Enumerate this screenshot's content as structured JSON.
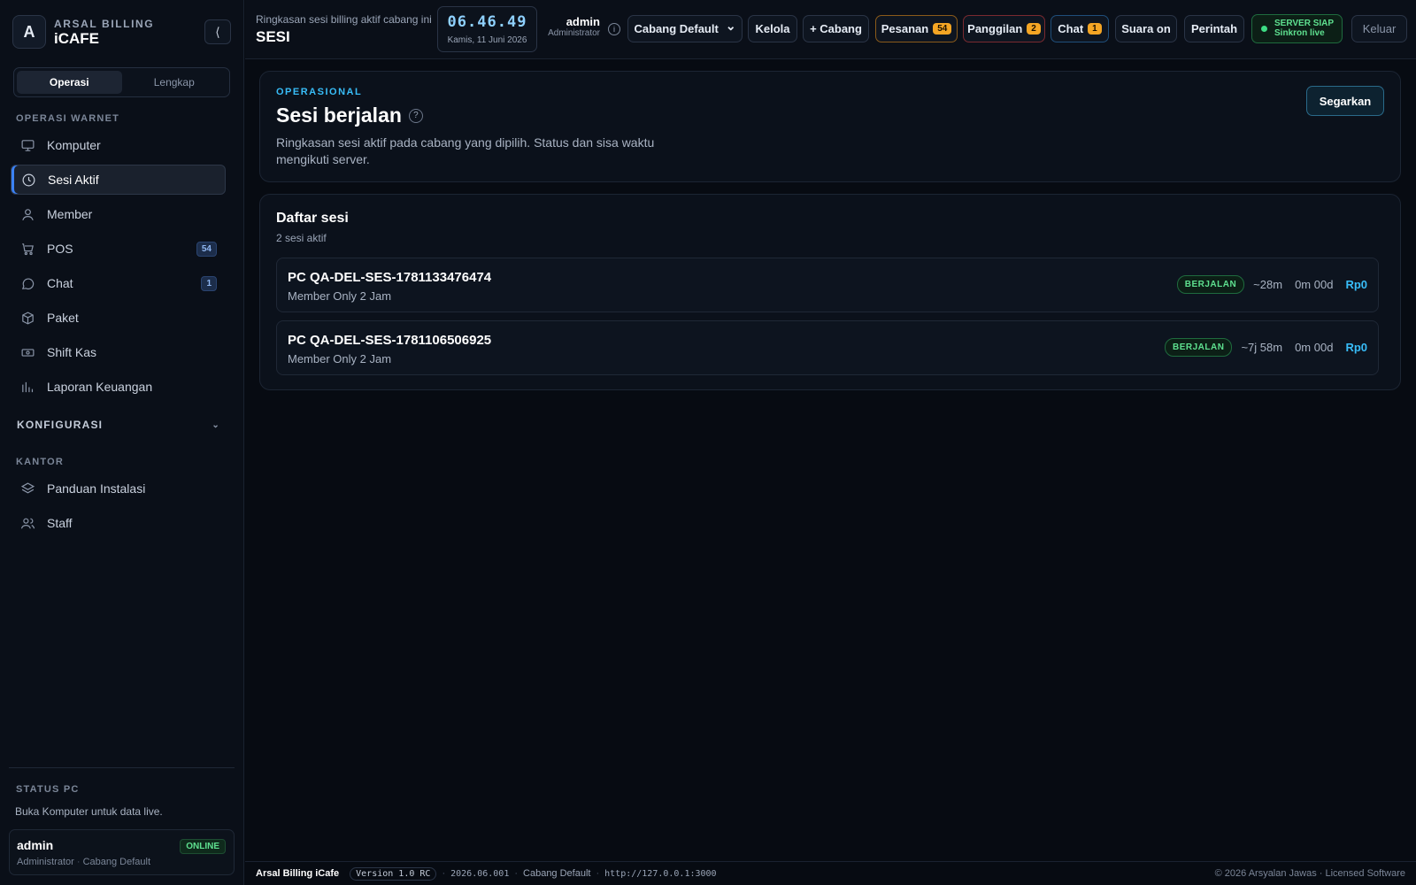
{
  "brand": {
    "logo_letter": "A",
    "subtitle": "ARSAL BILLING",
    "name": "iCAFE",
    "collapse_glyph": "⟨"
  },
  "mode_toggle": {
    "options": [
      "Operasi",
      "Lengkap"
    ],
    "active": "Operasi"
  },
  "sidebar": {
    "section_ops": "OPERASI WARNET",
    "items": [
      {
        "label": "Komputer",
        "icon": "monitor-icon"
      },
      {
        "label": "Sesi Aktif",
        "icon": "clock-icon",
        "active": true
      },
      {
        "label": "Member",
        "icon": "user-icon"
      },
      {
        "label": "POS",
        "icon": "cart-icon",
        "badge": "54"
      },
      {
        "label": "Chat",
        "icon": "chat-icon",
        "badge": "1"
      },
      {
        "label": "Paket",
        "icon": "box-icon"
      },
      {
        "label": "Shift Kas",
        "icon": "cash-icon"
      },
      {
        "label": "Laporan Keuangan",
        "icon": "bar-chart-icon"
      }
    ],
    "section_config": "KONFIGURASI",
    "section_office": "KANTOR",
    "office_items": [
      {
        "label": "Panduan Instalasi",
        "icon": "layers-icon"
      },
      {
        "label": "Staff",
        "icon": "users-icon"
      }
    ],
    "status_label": "STATUS PC",
    "status_text": "Buka Komputer untuk data live.",
    "user": {
      "name": "admin",
      "role": "Administrator",
      "branch": "Cabang Default",
      "status": "ONLINE"
    }
  },
  "topbar": {
    "caption": "Ringkasan sesi billing aktif cabang ini",
    "title": "SESI",
    "clock_time": "06.46.49",
    "clock_date": "Kamis, 11 Juni 2026",
    "admin_name": "admin",
    "admin_role": "Administrator",
    "branch_select": "Cabang Default",
    "kelola": "Kelola",
    "add_branch": "+ Cabang",
    "orders_label": "Pesanan",
    "orders_count": "54",
    "calls_label": "Panggilan",
    "calls_count": "2",
    "chat_label": "Chat",
    "chat_count": "1",
    "sound": "Suara on",
    "command": "Perintah",
    "server_status": "SERVER SIAP",
    "server_sync": "Sinkron live",
    "logout": "Keluar"
  },
  "header_card": {
    "eyebrow": "OPERASIONAL",
    "title": "Sesi berjalan",
    "help": "?",
    "description": "Ringkasan sesi aktif pada cabang yang dipilih. Status dan sisa waktu mengikuti server.",
    "refresh": "Segarkan"
  },
  "session_list": {
    "title": "Daftar sesi",
    "subtitle": "2 sesi aktif",
    "sessions": [
      {
        "pc": "PC QA-DEL-SES-1781133476474",
        "package": "Member Only 2 Jam",
        "status": "BERJALAN",
        "remaining": "~28m",
        "used": "0m 00d",
        "price": "Rp0"
      },
      {
        "pc": "PC QA-DEL-SES-1781106506925",
        "package": "Member Only 2 Jam",
        "status": "BERJALAN",
        "remaining": "~7j 58m",
        "used": "0m 00d",
        "price": "Rp0"
      }
    ]
  },
  "footer": {
    "app": "Arsal Billing iCafe",
    "version": "Version 1.0 RC",
    "build": "2026.06.001",
    "branch": "Cabang Default",
    "url": "http://127.0.0.1:3000",
    "copyright": "© 2026 Arsyalan Jawas · Licensed Software"
  },
  "colors": {
    "accent": "#38bdf8",
    "success": "#5ee08f",
    "warning": "#f4a524",
    "background": "#070b12"
  }
}
